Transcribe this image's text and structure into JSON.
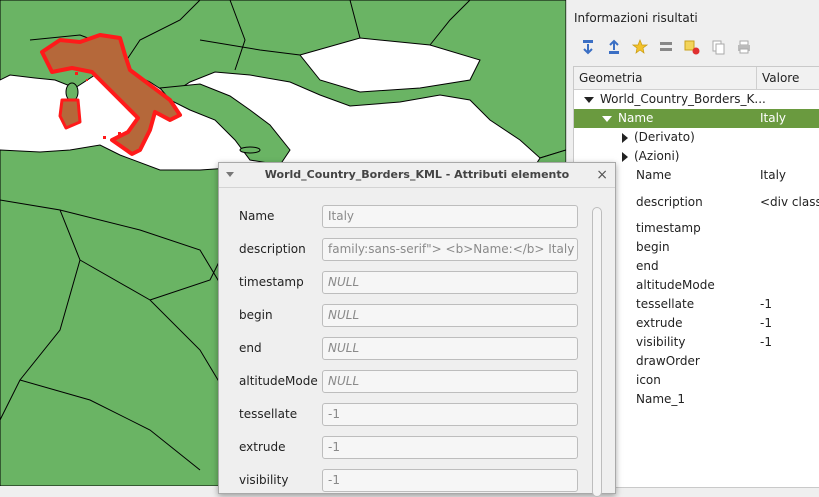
{
  "panel": {
    "title": "Informazioni risultati",
    "toolbar_icons": [
      "expand-tree-icon",
      "collapse-tree-icon",
      "expand-new-icon",
      "select-features-icon",
      "clear-results-icon",
      "copy-feature-icon",
      "print-icon"
    ],
    "columns": [
      "Geometria",
      "Valore"
    ],
    "tree": [
      {
        "label": "World_Country_Borders_K...",
        "value": "",
        "indent": 0,
        "arrow": "down",
        "selected": false
      },
      {
        "label": "Name",
        "value": "Italy",
        "indent": 1,
        "arrow": "down",
        "selected": true
      },
      {
        "label": "(Derivato)",
        "value": "",
        "indent": 2,
        "arrow": "right",
        "selected": false
      },
      {
        "label": "(Azioni)",
        "value": "",
        "indent": 2,
        "arrow": "right",
        "selected": false
      },
      {
        "label": "Name",
        "value": "Italy",
        "indent": 3,
        "arrow": "",
        "selected": false
      },
      {
        "label": "description",
        "value": "<div class=",
        "indent": 3,
        "arrow": "",
        "selected": false
      },
      {
        "label": "timestamp",
        "value": "",
        "indent": 3,
        "arrow": "",
        "selected": false
      },
      {
        "label": "begin",
        "value": "",
        "indent": 3,
        "arrow": "",
        "selected": false
      },
      {
        "label": "end",
        "value": "",
        "indent": 3,
        "arrow": "",
        "selected": false
      },
      {
        "label": "altitudeMode",
        "value": "",
        "indent": 3,
        "arrow": "",
        "selected": false
      },
      {
        "label": "tessellate",
        "value": "-1",
        "indent": 3,
        "arrow": "",
        "selected": false
      },
      {
        "label": "extrude",
        "value": "-1",
        "indent": 3,
        "arrow": "",
        "selected": false
      },
      {
        "label": "visibility",
        "value": "-1",
        "indent": 3,
        "arrow": "",
        "selected": false
      },
      {
        "label": "drawOrder",
        "value": "",
        "indent": 3,
        "arrow": "",
        "selected": false
      },
      {
        "label": "icon",
        "value": "",
        "indent": 3,
        "arrow": "",
        "selected": false
      },
      {
        "label": "Name_1",
        "value": "",
        "indent": 3,
        "arrow": "",
        "selected": false
      }
    ]
  },
  "dialog": {
    "title": "World_Country_Borders_KML - Attributi elemento",
    "close": "×",
    "fields": [
      {
        "label": "Name",
        "value": "Italy",
        "is_null": false
      },
      {
        "label": "description",
        "value": "family:sans-serif\"> <b>Name:</b> Italy </div>",
        "is_null": false
      },
      {
        "label": "timestamp",
        "value": "NULL",
        "is_null": true
      },
      {
        "label": "begin",
        "value": "NULL",
        "is_null": true
      },
      {
        "label": "end",
        "value": "NULL",
        "is_null": true
      },
      {
        "label": "altitudeMode",
        "value": "NULL",
        "is_null": true
      },
      {
        "label": "tessellate",
        "value": "-1",
        "is_null": false
      },
      {
        "label": "extrude",
        "value": "-1",
        "is_null": false
      },
      {
        "label": "visibility",
        "value": "-1",
        "is_null": false
      }
    ]
  },
  "map": {
    "land_color": "#6ab464",
    "sea_color": "#ffffff",
    "highlight_fill": "#b5683a",
    "highlight_stroke": "#ff1a1a"
  },
  "colors": {
    "selection": "#6a9a3f"
  }
}
